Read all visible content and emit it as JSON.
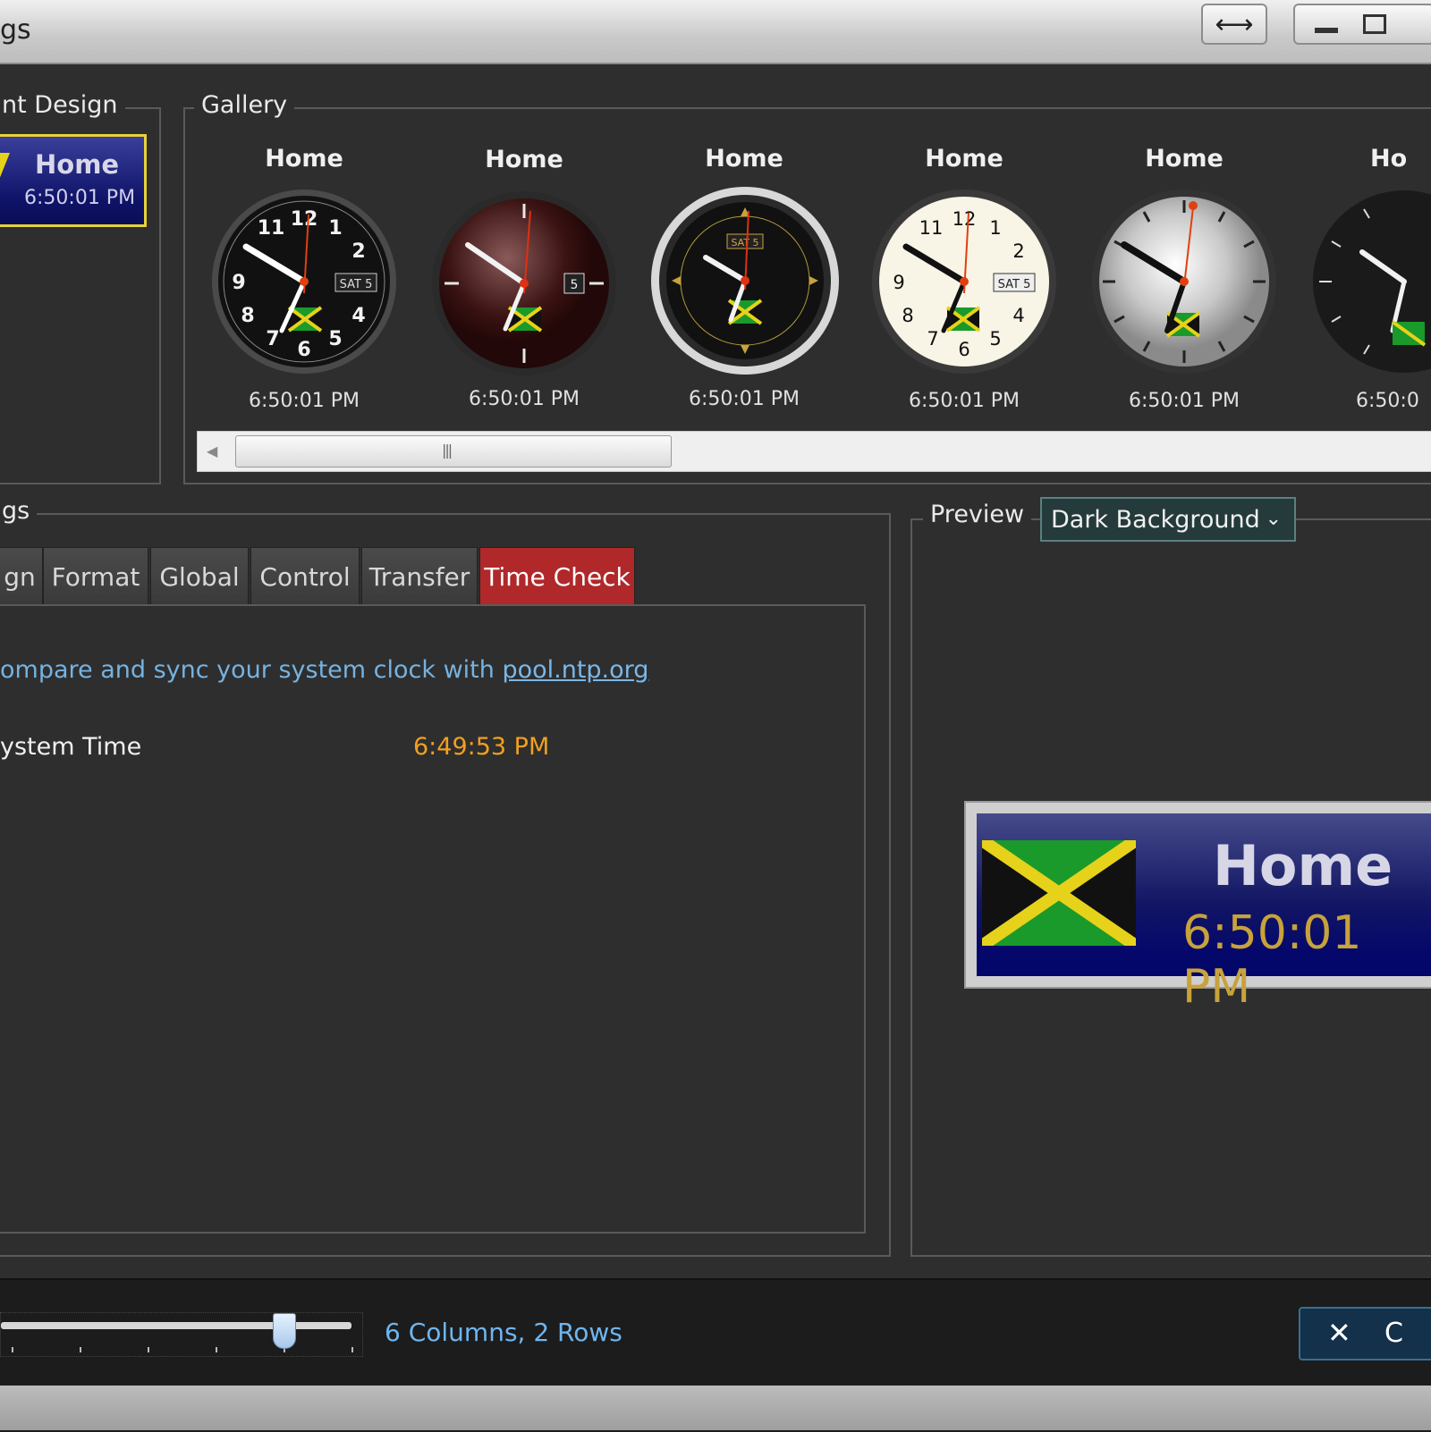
{
  "window": {
    "title": "gs"
  },
  "current_design": {
    "label": "nt Design",
    "tile": {
      "name": "Home",
      "time": "6:50:01 PM"
    }
  },
  "gallery": {
    "label": "Gallery",
    "items": [
      {
        "name": "Home",
        "time": "6:50:01 PM",
        "date": "SAT 5"
      },
      {
        "name": "Home",
        "time": "6:50:01 PM",
        "date": "5"
      },
      {
        "name": "Home",
        "time": "6:50:01 PM",
        "date": "SAT 5"
      },
      {
        "name": "Home",
        "time": "6:50:01 PM",
        "date": "SAT 5"
      },
      {
        "name": "Home",
        "time": "6:50:01 PM"
      },
      {
        "name": "Ho",
        "time": "6:50:0"
      }
    ],
    "numerals": [
      "12",
      "1",
      "2",
      "4",
      "5",
      "6",
      "7",
      "8",
      "9",
      "11"
    ]
  },
  "settings": {
    "label": "gs",
    "tabs": [
      {
        "label": "gn",
        "active": false
      },
      {
        "label": "Format",
        "active": false
      },
      {
        "label": "Global",
        "active": false
      },
      {
        "label": "Control",
        "active": false
      },
      {
        "label": "Transfer",
        "active": false
      },
      {
        "label": "Time Check",
        "active": true
      }
    ],
    "time_check": {
      "sync_text": "ompare and sync your system clock with ",
      "sync_link": "pool.ntp.org",
      "system_time_label": "ystem Time",
      "system_time_value": "6:49:53 PM"
    }
  },
  "preview": {
    "label": "Preview",
    "background_select": "Dark Background",
    "tile": {
      "name": "Home",
      "time": "6:50:01 PM"
    }
  },
  "footer": {
    "size_slider": {
      "value_fraction": 0.79
    },
    "columns_rows": "6 Columns, 2 Rows",
    "close_label": "C"
  },
  "colors": {
    "accent_red": "#b0282a",
    "link_blue": "#7ab7e8",
    "time_orange": "#f0a020",
    "flag_green": "#1a9a2a",
    "flag_yellow": "#e6d21a"
  }
}
